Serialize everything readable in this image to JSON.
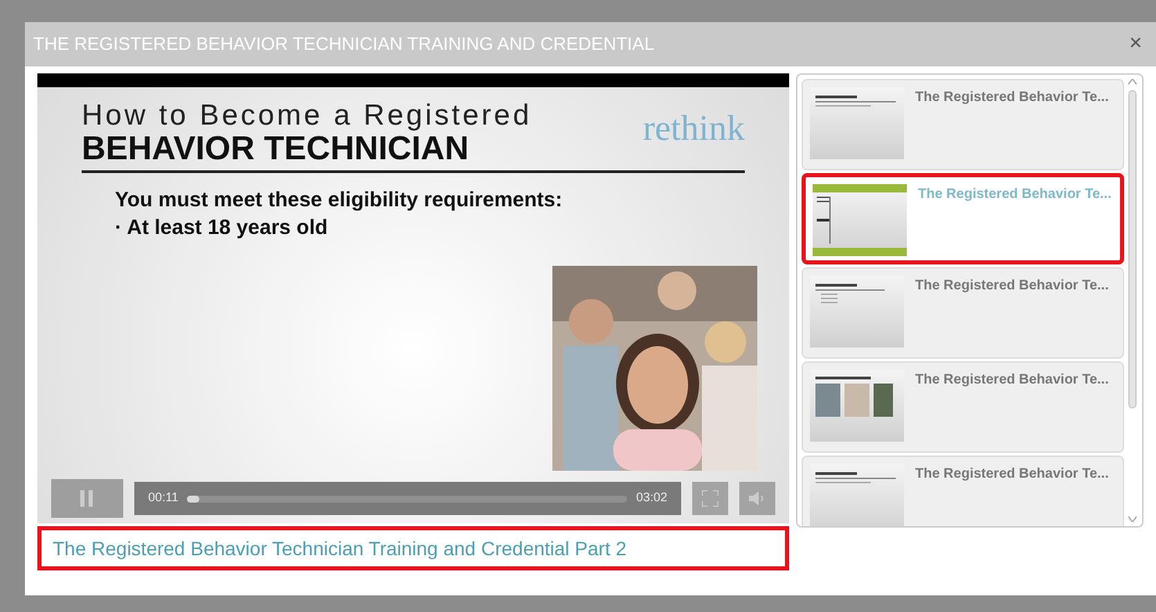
{
  "dialog": {
    "title": "THE REGISTERED BEHAVIOR TECHNICIAN TRAINING AND CREDENTIAL",
    "close": "×"
  },
  "slide": {
    "heading_small": "How to Become a Registered",
    "heading_large": "BEHAVIOR TECHNICIAN",
    "logo": "rethink",
    "lines": [
      "You must meet these eligibility requirements:",
      "· At least 18 years old"
    ]
  },
  "player": {
    "playing": true,
    "elapsed": "00:11",
    "level": 0.03,
    "duration": "03:02"
  },
  "caption": {
    "text": "The Registered Behavior Technician Training and Credential Part 2",
    "highlighted": true
  },
  "playlist": [
    {
      "title": "The Registered Behavior Te...",
      "selected": false,
      "highlighted": false,
      "kind": "plain"
    },
    {
      "title": "The Registered Behavior Te...",
      "selected": true,
      "highlighted": true,
      "kind": "green"
    },
    {
      "title": "The Registered Behavior Te...",
      "selected": false,
      "highlighted": false,
      "kind": "list"
    },
    {
      "title": "The Registered Behavior Te...",
      "selected": false,
      "highlighted": false,
      "kind": "photos"
    },
    {
      "title": "The Registered Behavior Te...",
      "selected": false,
      "highlighted": false,
      "kind": "plain"
    }
  ]
}
